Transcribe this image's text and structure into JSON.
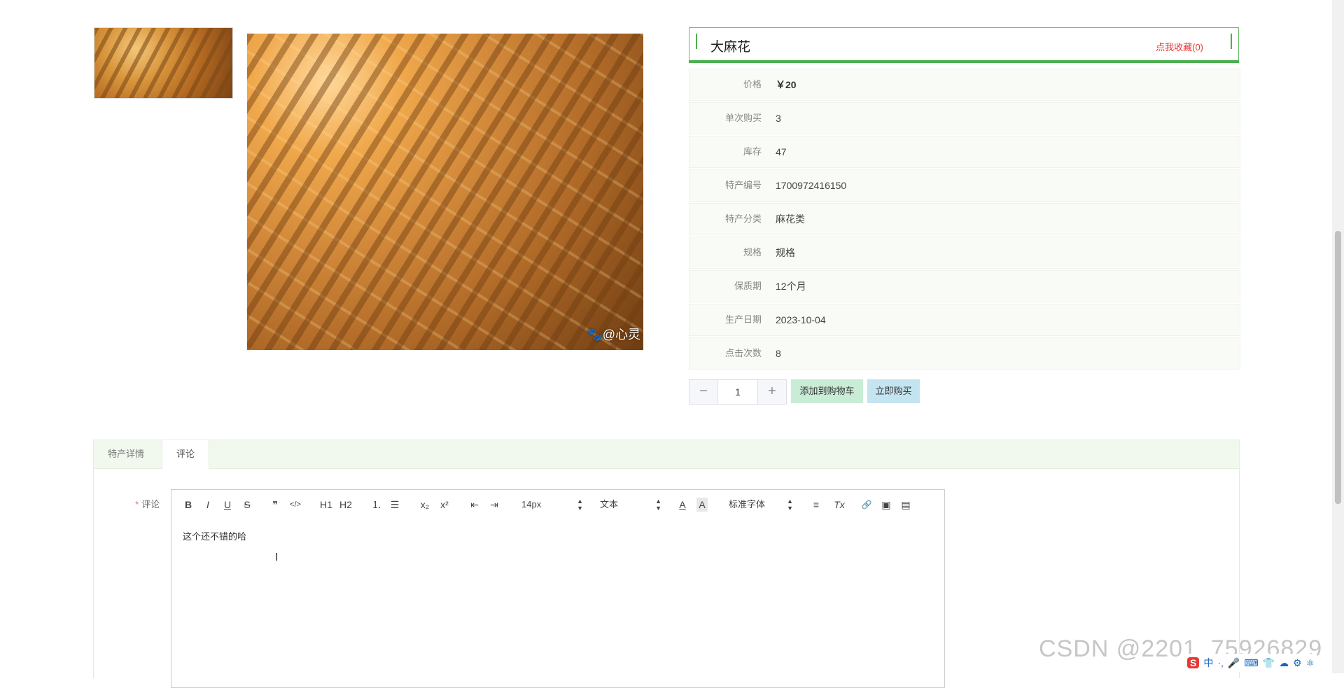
{
  "product": {
    "name": "大麻花",
    "favorite": "点我收藏(0)",
    "image_watermark": "@心灵"
  },
  "info": [
    {
      "label": "价格",
      "value": "￥20"
    },
    {
      "label": "单次购买",
      "value": "3"
    },
    {
      "label": "库存",
      "value": "47"
    },
    {
      "label": "特产编号",
      "value": "1700972416150"
    },
    {
      "label": "特产分类",
      "value": "麻花类"
    },
    {
      "label": "规格",
      "value": "规格"
    },
    {
      "label": "保质期",
      "value": "12个月"
    },
    {
      "label": "生产日期",
      "value": "2023-10-04"
    },
    {
      "label": "点击次数",
      "value": "8"
    }
  ],
  "purchase": {
    "quantity": "1",
    "minus": "−",
    "plus": "+",
    "add_to_cart": "添加到购物车",
    "buy_now": "立即购买"
  },
  "tabs": [
    {
      "label": "特产详情"
    },
    {
      "label": "评论"
    }
  ],
  "comment": {
    "required_mark": "*",
    "label": "评论",
    "text": "这个还不错的哈"
  },
  "toolbar": {
    "bold": "B",
    "italic": "I",
    "underline": "U",
    "strike": "S",
    "quote": "❞",
    "code": "</>",
    "h1": "H1",
    "h2": "H2",
    "ordered_list": "⒈",
    "bullet_list": "☰",
    "subscript": "x₂",
    "superscript": "x²",
    "outdent": "⇤",
    "indent": "⇥",
    "font_size": "14px",
    "header_select": "文本",
    "color": "A",
    "background": "A",
    "font_family": "标准字体",
    "align": "≡",
    "clean": "Tx",
    "link": "🔗",
    "image": "▣",
    "video": "▤"
  },
  "overlay": {
    "watermark": "CSDN @2201_75926829",
    "ime_logo": "S",
    "ime_items": [
      "中",
      "·,",
      "🎤",
      "⌨",
      "👕",
      "☁",
      "⚙",
      "⚛"
    ]
  },
  "colors": {
    "accent": "#4caf50",
    "favorite": "#e53935",
    "cart_button": "#c8ecd6",
    "buy_button": "#c4e4f2"
  }
}
